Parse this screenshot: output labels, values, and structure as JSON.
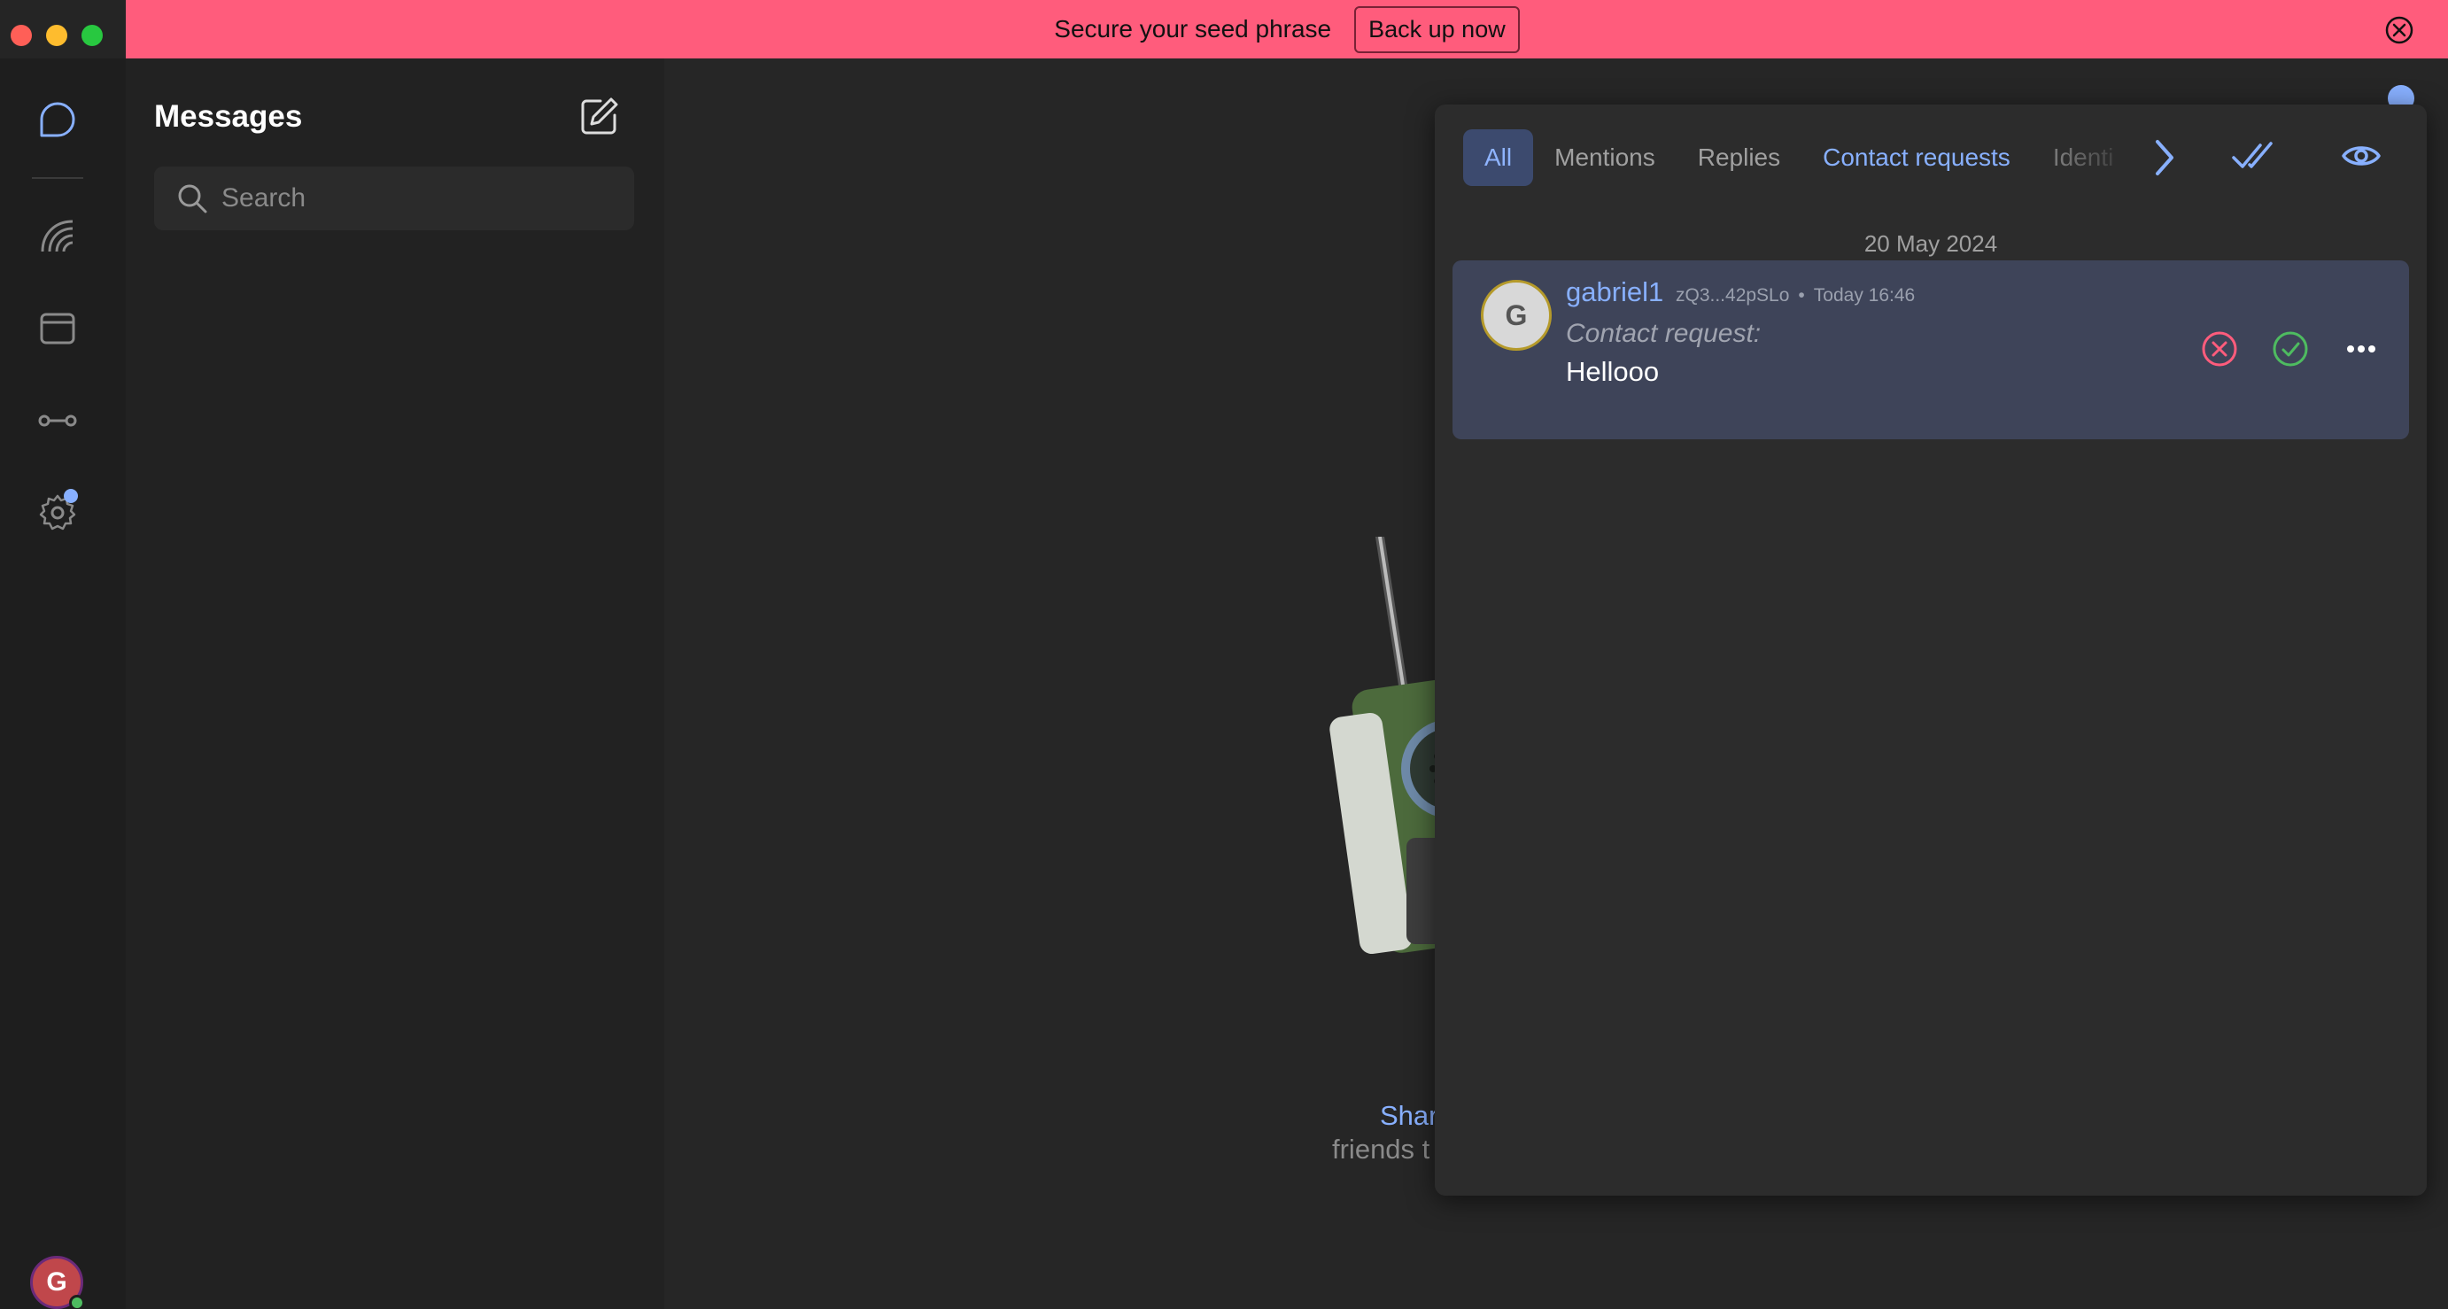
{
  "banner": {
    "text": "Secure your seed phrase",
    "button": "Back up now",
    "color": "#ff5c7c"
  },
  "rail": {
    "items": [
      "chat-icon",
      "communities-icon",
      "wallet-icon",
      "node-icon",
      "settings-icon"
    ],
    "avatar_initial": "G"
  },
  "messages": {
    "title": "Messages",
    "search_placeholder": "Search"
  },
  "empty_state": {
    "link": "Shar",
    "subtext": "friends t"
  },
  "notifications": {
    "tabs": [
      {
        "label": "All",
        "active": true
      },
      {
        "label": "Mentions"
      },
      {
        "label": "Replies"
      },
      {
        "label": "Contact requests"
      },
      {
        "label": "Identi"
      }
    ],
    "date": "20 May 2024",
    "items": [
      {
        "avatar_initial": "G",
        "name": "gabriel1",
        "key": "zQ3...42pSLo",
        "separator": "•",
        "time": "Today 16:46",
        "label": "Contact request:",
        "message": "Hellooo"
      }
    ]
  },
  "colors": {
    "accent": "#88b0ff",
    "decline": "#ff5c7c",
    "accept": "#4ebc60"
  }
}
